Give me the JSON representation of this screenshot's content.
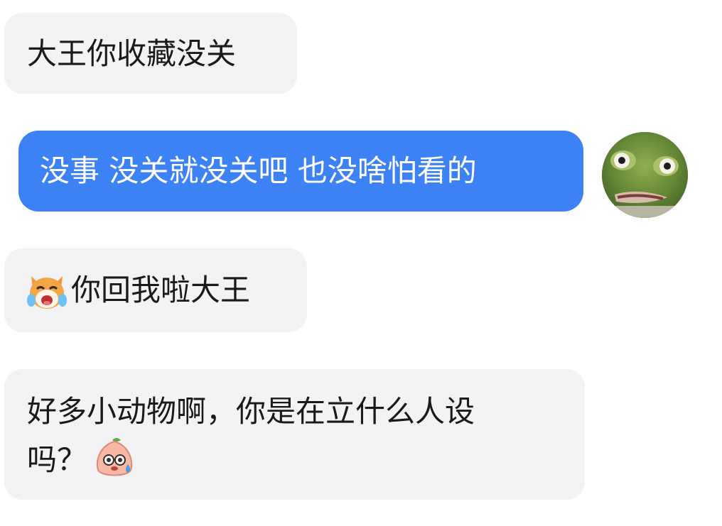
{
  "messages": [
    {
      "side": "left",
      "text": "大王你收藏没关"
    },
    {
      "side": "right",
      "text": "没事 没关就没关吧 也没啥怕看的"
    },
    {
      "side": "left",
      "emoji": "cat-laugh-cry-icon",
      "text": "你回我啦大王"
    },
    {
      "side": "left",
      "line1": "好多小动物啊，你是在立什么人设",
      "line2": "吗？",
      "emoji": "peach-sweat-icon"
    }
  ],
  "avatar": {
    "description_icon": "frog-avatar-icon"
  },
  "colors": {
    "outgoing_bubble": "#3d82f5",
    "incoming_bubble": "#f3f3f5",
    "text": "#1a1a1a"
  }
}
